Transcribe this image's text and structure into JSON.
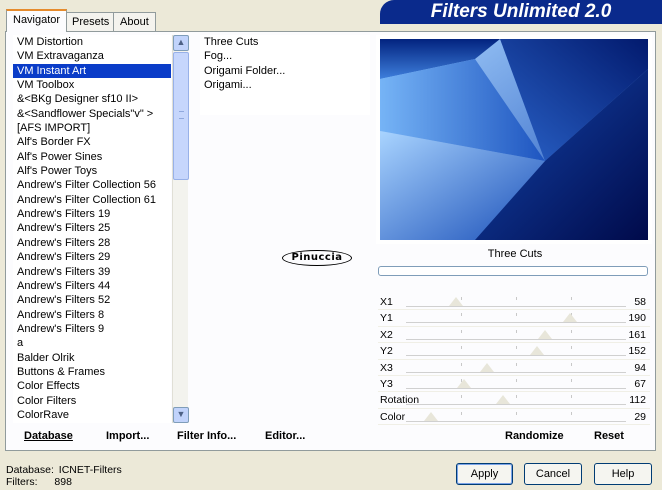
{
  "tabs": [
    "Navigator",
    "Presets",
    "About"
  ],
  "banner_title": "Filters Unlimited 2.0",
  "filter_categories": [
    "VM Distortion",
    "VM Extravaganza",
    "VM Instant Art",
    "VM Toolbox",
    "&<BKg Designer sf10 II>",
    "&<Sandflower Specials\"v\" >",
    "[AFS IMPORT]",
    "Alf's Border FX",
    "Alf's Power Sines",
    "Alf's Power Toys",
    "Andrew's Filter Collection 56",
    "Andrew's Filter Collection 61",
    "Andrew's Filters 19",
    "Andrew's Filters 25",
    "Andrew's Filters 28",
    "Andrew's Filters 29",
    "Andrew's Filters 39",
    "Andrew's Filters 44",
    "Andrew's Filters 52",
    "Andrew's Filters 8",
    "Andrew's Filters 9",
    "a",
    "Balder Olrik",
    "Buttons & Frames",
    "Color Effects",
    "Color Filters",
    "ColorRave"
  ],
  "selected_category": "VM Instant Art",
  "effects": [
    "Three Cuts",
    "Fog...",
    "Origami Folder...",
    "Origami..."
  ],
  "selected_effect": "Three Cuts",
  "logo_text": "Pinuccia",
  "current_filter_name": "Three Cuts",
  "sliders": [
    {
      "label": "X1",
      "value": 58
    },
    {
      "label": "Y1",
      "value": 190
    },
    {
      "label": "X2",
      "value": 161
    },
    {
      "label": "Y2",
      "value": 152
    },
    {
      "label": "X3",
      "value": 94
    },
    {
      "label": "Y3",
      "value": 67
    },
    {
      "label": "Rotation",
      "value": 112
    },
    {
      "label": "Color",
      "value": 29
    }
  ],
  "commands": {
    "database": "Database",
    "import": "Import...",
    "filter_info": "Filter Info...",
    "editor": "Editor...",
    "randomize": "Randomize",
    "reset": "Reset"
  },
  "footer": {
    "database_label": "Database:",
    "database_value": "ICNET-Filters",
    "filters_label": "Filters:",
    "filters_value": "898"
  },
  "buttons": {
    "apply": "Apply",
    "cancel": "Cancel",
    "help": "Help"
  },
  "colors": {
    "banner_bg": "#0a2a8c",
    "selection_bg": "#0a3cc8",
    "preview_dark": "#021a6e",
    "preview_light": "#a6d2ff"
  }
}
